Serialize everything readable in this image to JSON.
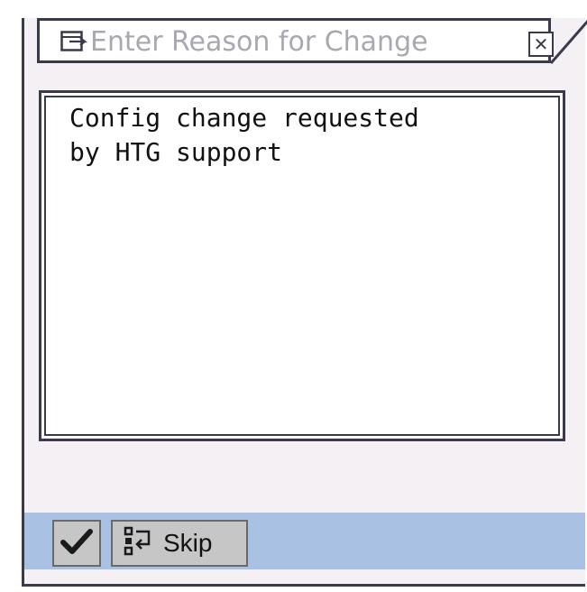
{
  "dialog": {
    "title": "Enter Reason for Change",
    "close_symbol": "✕",
    "text_lines": [
      "Config change requested",
      "by HTG support"
    ]
  },
  "footer": {
    "confirm_icon": "checkmark-icon",
    "skip_icon": "skip-icon",
    "skip_label": "Skip"
  },
  "colors": {
    "dialog_bg": "#f4f0f3",
    "footer_bg": "#a9c2e3",
    "button_bg": "#c6c6c6",
    "title_text": "#a8a8b0",
    "border": "#3a3a4a"
  }
}
